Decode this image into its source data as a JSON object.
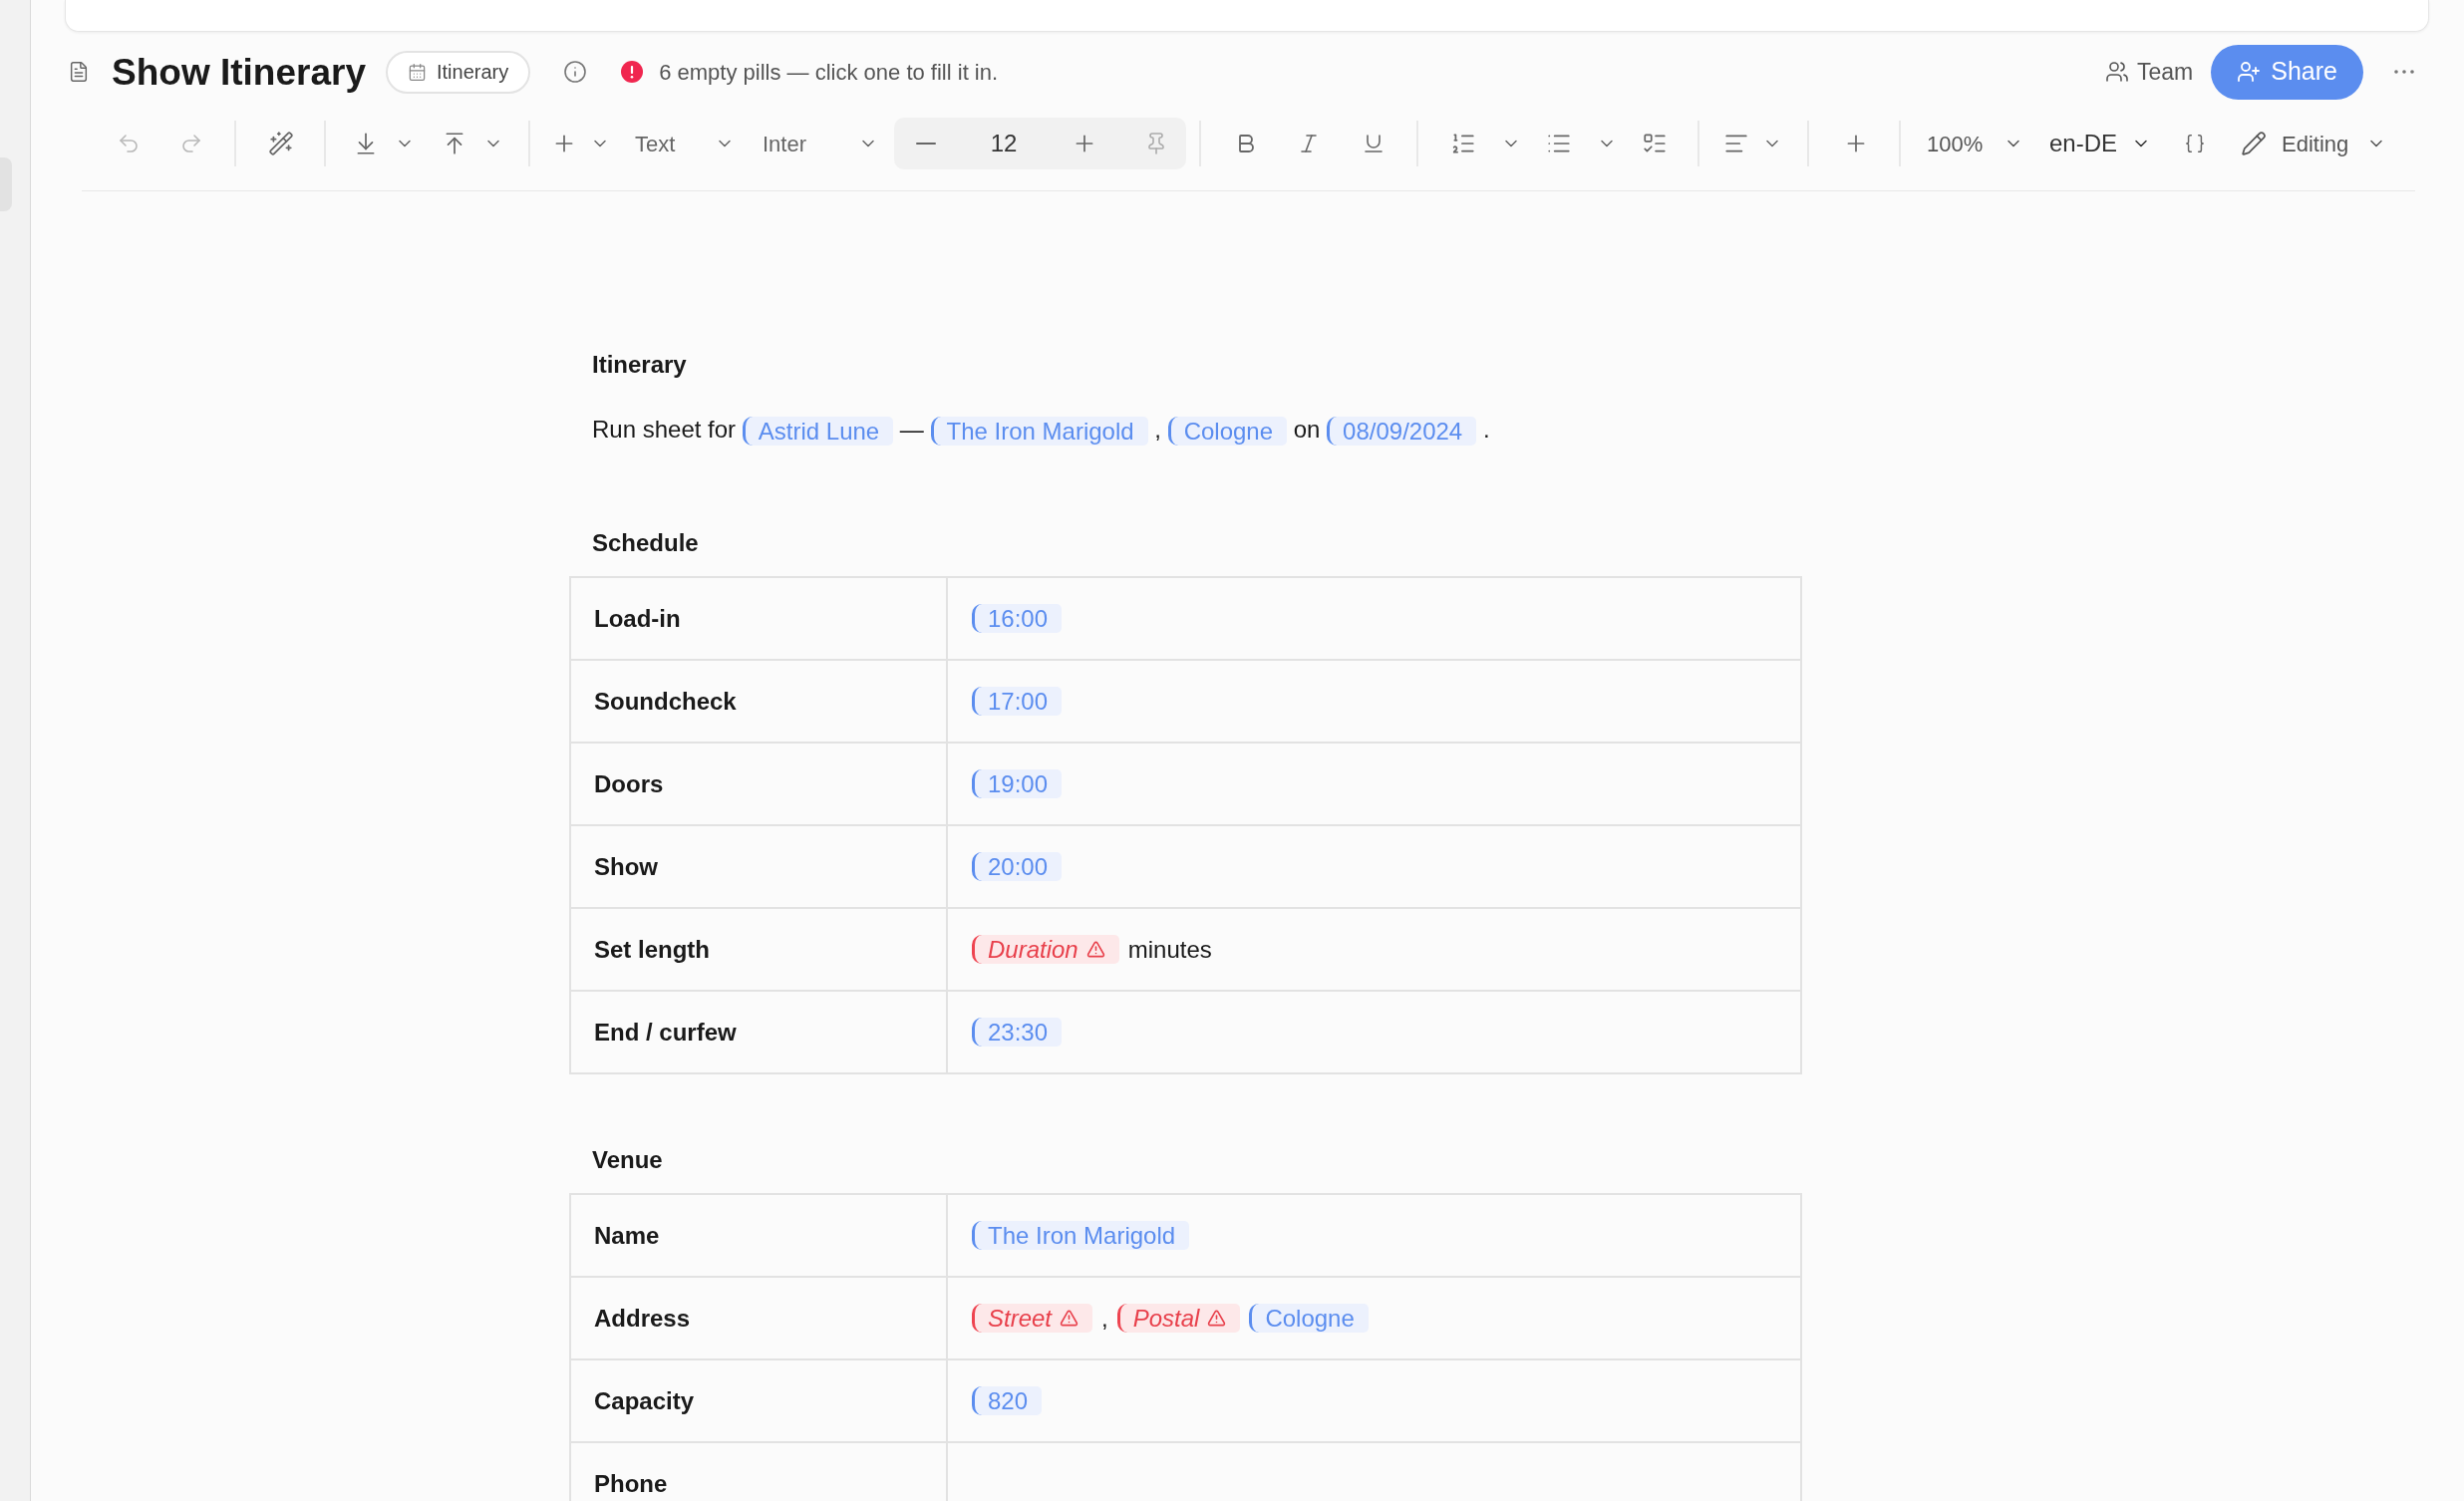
{
  "document_title": "Show Itinerary",
  "template_badge": "Itinerary",
  "status_message": "6 empty pills — click one to fill it in.",
  "team_button": "Team",
  "share_button": "Share",
  "toolbar": {
    "undo": {
      "disabled": true
    },
    "redo": {
      "disabled": true
    },
    "block_type": "Text",
    "font_family": "Inter",
    "font_size": "12",
    "zoom": "100%",
    "language": "en-DE",
    "mode": "Editing"
  },
  "document": {
    "title": "Itinerary",
    "intro": [
      {
        "kind": "text",
        "text": "Run sheet for"
      },
      {
        "kind": "pill",
        "text": "Astrid Lune",
        "empty": false
      },
      {
        "kind": "text",
        "text": "—"
      },
      {
        "kind": "pill",
        "text": "The Iron Marigold",
        "empty": false
      },
      {
        "kind": "text",
        "text": ","
      },
      {
        "kind": "pill",
        "text": "Cologne",
        "empty": false
      },
      {
        "kind": "text",
        "text": "on"
      },
      {
        "kind": "pill",
        "text": "08/09/2024",
        "empty": false
      },
      {
        "kind": "text",
        "text": "."
      }
    ],
    "sections": [
      {
        "heading": "Schedule",
        "rows": [
          {
            "label": "Load-in",
            "value": [
              {
                "kind": "pill",
                "text": "16:00",
                "empty": false
              }
            ]
          },
          {
            "label": "Soundcheck",
            "value": [
              {
                "kind": "pill",
                "text": "17:00",
                "empty": false
              }
            ]
          },
          {
            "label": "Doors",
            "value": [
              {
                "kind": "pill",
                "text": "19:00",
                "empty": false
              }
            ]
          },
          {
            "label": "Show",
            "value": [
              {
                "kind": "pill",
                "text": "20:00",
                "empty": false
              }
            ]
          },
          {
            "label": "Set length",
            "value": [
              {
                "kind": "pill",
                "text": "Duration",
                "empty": true
              },
              {
                "kind": "text",
                "text": "minutes"
              }
            ]
          },
          {
            "label": "End / curfew",
            "value": [
              {
                "kind": "pill",
                "text": "23:30",
                "empty": false
              }
            ]
          }
        ]
      },
      {
        "heading": "Venue",
        "rows": [
          {
            "label": "Name",
            "value": [
              {
                "kind": "pill",
                "text": "The Iron Marigold",
                "empty": false
              }
            ]
          },
          {
            "label": "Address",
            "value": [
              {
                "kind": "pill",
                "text": "Street",
                "empty": true
              },
              {
                "kind": "text",
                "text": ","
              },
              {
                "kind": "pill",
                "text": "Postal",
                "empty": true
              },
              {
                "kind": "pill",
                "text": "Cologne",
                "empty": false
              }
            ]
          },
          {
            "label": "Capacity",
            "value": [
              {
                "kind": "pill",
                "text": "820",
                "empty": false
              }
            ]
          },
          {
            "label": "Phone"
          }
        ]
      }
    ]
  }
}
